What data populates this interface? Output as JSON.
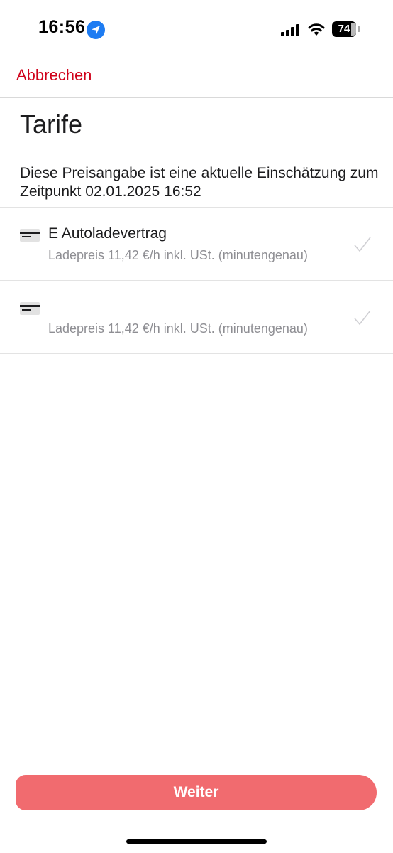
{
  "status_bar": {
    "time": "16:56",
    "battery_level": "74",
    "icons": [
      "location-arrow-icon",
      "cellular-signal-icon",
      "wifi-icon",
      "battery-icon"
    ]
  },
  "nav": {
    "cancel_label": "Abbrechen"
  },
  "page": {
    "title": "Tarife",
    "notice": "Diese Preisangabe ist eine aktuelle Einschätzung zum Zeitpunkt 02.01.2025 16:52"
  },
  "tariffs": [
    {
      "name": "E Autoladevertrag",
      "price": "Ladepreis 11,42 €/h inkl. USt. (minutengenau)",
      "icon": "credit-card-icon"
    },
    {
      "name": "",
      "price": "Ladepreis 11,42 €/h inkl. USt. (minutengenau)",
      "icon": "credit-card-icon"
    }
  ],
  "footer": {
    "continue_label": "Weiter"
  },
  "colors": {
    "accent_red": "#d0021b",
    "button_bg": "#f16b6f",
    "location_blue": "#1e7cf2",
    "secondary_text": "#8e8e93"
  }
}
